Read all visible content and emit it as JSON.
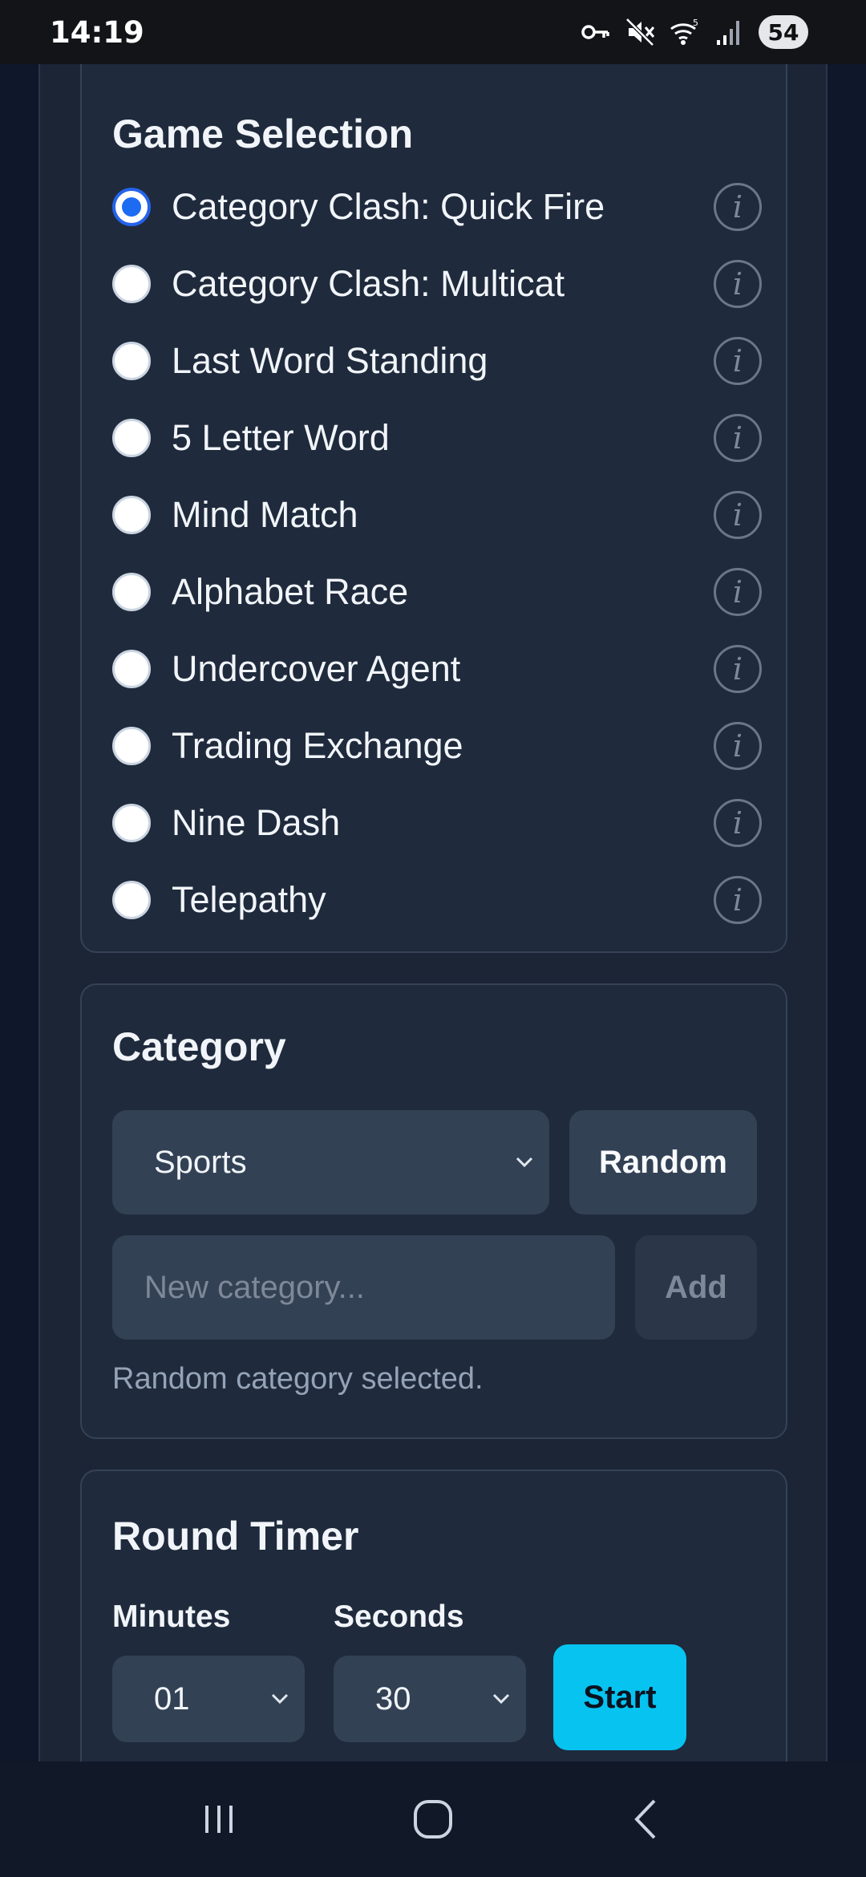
{
  "status_bar": {
    "time": "14:19",
    "battery": "54",
    "icons": [
      "vpn-key-icon",
      "mute-icon",
      "wifi-icon",
      "signal-icon"
    ]
  },
  "game_selection": {
    "title": "Game Selection",
    "selected_index": 0,
    "games": [
      {
        "label": "Category Clash: Quick Fire",
        "selected": true
      },
      {
        "label": "Category Clash: Multicat",
        "selected": false
      },
      {
        "label": "Last Word Standing",
        "selected": false
      },
      {
        "label": "5 Letter Word",
        "selected": false
      },
      {
        "label": "Mind Match",
        "selected": false
      },
      {
        "label": "Alphabet Race",
        "selected": false
      },
      {
        "label": "Undercover Agent",
        "selected": false
      },
      {
        "label": "Trading Exchange",
        "selected": false
      },
      {
        "label": "Nine Dash",
        "selected": false
      },
      {
        "label": "Telepathy",
        "selected": false
      }
    ],
    "info_icon_glyph": "i"
  },
  "category": {
    "title": "Category",
    "selected_value": "Sports",
    "random_label": "Random",
    "new_category_placeholder": "New category...",
    "new_category_value": "",
    "add_label": "Add",
    "status_message": "Random category selected."
  },
  "round_timer": {
    "title": "Round Timer",
    "minutes_label": "Minutes",
    "minutes_value": "01",
    "seconds_label": "Seconds",
    "seconds_value": "30",
    "start_label": "Start"
  },
  "colors": {
    "background": "#0f172a",
    "card": "#1f2a3c",
    "input": "#334155",
    "accent": "#06c3f0",
    "radio_selected": "#1d6bf3"
  }
}
